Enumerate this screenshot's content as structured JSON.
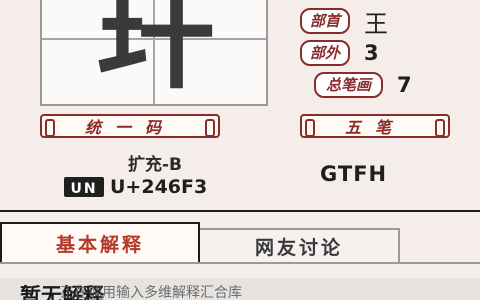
{
  "character": {
    "glyph": "玕"
  },
  "properties": [
    {
      "label": "部首",
      "value": "王"
    },
    {
      "label": "部外",
      "value": "3"
    },
    {
      "label": "总笔画",
      "value": "7"
    }
  ],
  "banners": {
    "left": "统一码",
    "right": "五笔"
  },
  "extension": "扩充-B",
  "unicode": {
    "icon_text": "UN",
    "value": "U+246F3"
  },
  "wubi_code": "GTFH",
  "tabs": [
    {
      "label": "基本解释"
    },
    {
      "label": "网友讨论"
    }
  ],
  "bottom": {
    "title": "暂无解释",
    "overlay": "正在调用输入多维解释汇合库"
  },
  "colors": {
    "accent": "#8a2c2c",
    "active_tab_text": "#b33a2a",
    "background": "#f4ede9"
  }
}
